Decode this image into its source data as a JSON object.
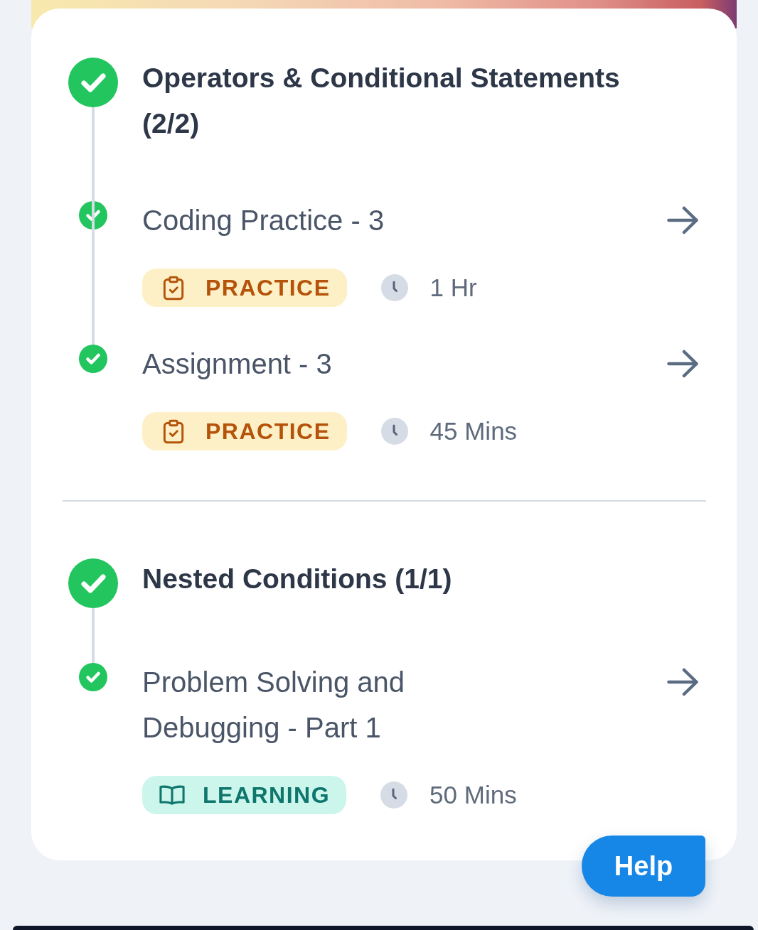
{
  "sections": [
    {
      "title": "Operators & Conditional Statements (2/2)",
      "completed": true,
      "items": [
        {
          "title": "Coding Practice - 3",
          "completed": true,
          "tag": {
            "kind": "practice",
            "label": "PRACTICE"
          },
          "duration": "1 Hr"
        },
        {
          "title": "Assignment - 3",
          "completed": true,
          "tag": {
            "kind": "practice",
            "label": "PRACTICE"
          },
          "duration": "45 Mins"
        }
      ]
    },
    {
      "title": "Nested Conditions (1/1)",
      "completed": true,
      "items": [
        {
          "title": "Problem Solving and Debugging - Part 1",
          "completed": true,
          "tag": {
            "kind": "learning",
            "label": "LEARNING"
          },
          "duration": "50 Mins"
        }
      ]
    }
  ],
  "help_button": {
    "label": "Help"
  }
}
